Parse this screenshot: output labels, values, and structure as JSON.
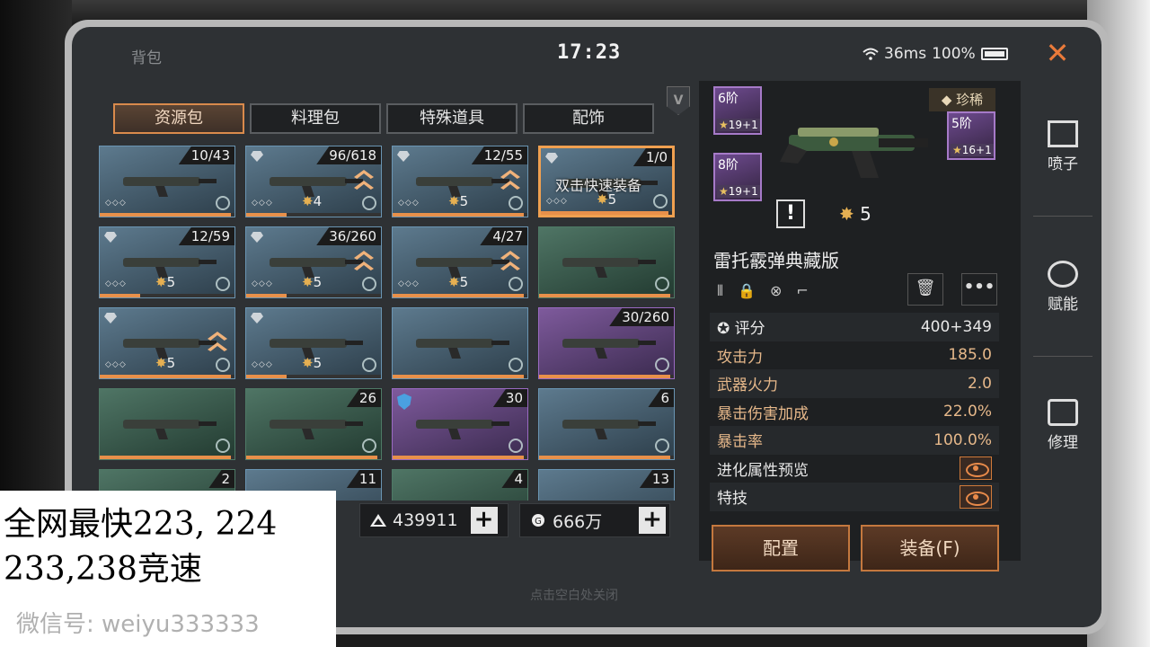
{
  "status": {
    "title": "背包",
    "time": "17:23",
    "ping": "36ms",
    "battery": "100%"
  },
  "vip_badge": "V",
  "tabs": [
    "资源包",
    "料理包",
    "特殊道具",
    "配饰"
  ],
  "grid": [
    {
      "count": "10/43",
      "stars": "",
      "diamond": false,
      "dots": true,
      "upgrade": false,
      "bar": 0.97,
      "rarity": "blue"
    },
    {
      "count": "96/618",
      "stars": "4",
      "diamond": true,
      "dots": true,
      "upgrade": true,
      "bar": 0.3,
      "rarity": "blue"
    },
    {
      "count": "12/55",
      "stars": "5",
      "diamond": true,
      "dots": true,
      "upgrade": true,
      "bar": 0.97,
      "rarity": "blue"
    },
    {
      "count": "1/0",
      "stars": "5",
      "diamond": true,
      "dots": true,
      "upgrade": false,
      "bar": 0.97,
      "rarity": "blue",
      "selected": true,
      "overlay": "双击快速装备"
    },
    {
      "count": "12/59",
      "stars": "5",
      "diamond": true,
      "dots": true,
      "upgrade": false,
      "bar": 0.3,
      "rarity": "blue"
    },
    {
      "count": "36/260",
      "stars": "5",
      "diamond": true,
      "dots": true,
      "upgrade": true,
      "bar": 0.3,
      "rarity": "blue"
    },
    {
      "count": "4/27",
      "stars": "5",
      "diamond": false,
      "dots": true,
      "upgrade": true,
      "bar": 0.97,
      "rarity": "blue"
    },
    {
      "count": "",
      "stars": "",
      "diamond": false,
      "dots": false,
      "upgrade": false,
      "bar": 0.97,
      "rarity": "green"
    },
    {
      "count": "",
      "stars": "5",
      "diamond": true,
      "dots": true,
      "upgrade": true,
      "bar": 0.97,
      "rarity": "blue"
    },
    {
      "count": "",
      "stars": "5",
      "diamond": true,
      "dots": true,
      "upgrade": false,
      "bar": 0.3,
      "rarity": "blue"
    },
    {
      "count": "",
      "stars": "",
      "diamond": false,
      "dots": false,
      "upgrade": false,
      "bar": 0.97,
      "rarity": "blue"
    },
    {
      "count": "30/260",
      "stars": "",
      "diamond": false,
      "dots": false,
      "upgrade": false,
      "bar": 0.97,
      "rarity": "purple"
    },
    {
      "count": "",
      "stars": "",
      "diamond": false,
      "dots": false,
      "upgrade": false,
      "bar": 0.97,
      "rarity": "green"
    },
    {
      "count": "26",
      "stars": "",
      "diamond": false,
      "dots": false,
      "upgrade": false,
      "bar": 0.97,
      "rarity": "green"
    },
    {
      "count": "30",
      "stars": "",
      "diamond": false,
      "dots": false,
      "upgrade": false,
      "bar": 0.97,
      "rarity": "purple",
      "shield": true
    },
    {
      "count": "6",
      "stars": "",
      "diamond": false,
      "dots": false,
      "upgrade": false,
      "bar": 0.97,
      "rarity": "blue"
    },
    {
      "count": "2",
      "stars": "",
      "diamond": false,
      "dots": false,
      "upgrade": false,
      "bar": 0,
      "rarity": "green"
    },
    {
      "count": "11",
      "stars": "",
      "diamond": false,
      "dots": false,
      "upgrade": false,
      "bar": 0,
      "rarity": "blue"
    },
    {
      "count": "4",
      "stars": "",
      "diamond": false,
      "dots": false,
      "upgrade": false,
      "bar": 0,
      "rarity": "green"
    },
    {
      "count": "13",
      "stars": "",
      "diamond": false,
      "dots": false,
      "upgrade": false,
      "bar": 0,
      "rarity": "blue"
    }
  ],
  "resources": {
    "gold": "439911",
    "coins": "666万",
    "plus": "+"
  },
  "hint": "点击空白处关闭",
  "detail": {
    "rarity": "珍稀",
    "tier_6": {
      "label": "6阶",
      "stars": "19+1"
    },
    "tier_8": {
      "label": "8阶",
      "stars": "19+1"
    },
    "tier_5": {
      "label": "5阶",
      "stars": "16+1"
    },
    "excl": "!",
    "star_level": "5",
    "name": "雷托霰弹典藏版",
    "trash": "🗑",
    "more": "•••",
    "stats": [
      {
        "k": "评分",
        "v": "400+349",
        "white": true
      },
      {
        "k": "攻击力",
        "v": "185.0"
      },
      {
        "k": "武器火力",
        "v": "2.0"
      },
      {
        "k": "暴击伤害加成",
        "v": "22.0%"
      },
      {
        "k": "暴击率",
        "v": "100.0%"
      },
      {
        "k": "进化属性预览",
        "eye": true,
        "white": true
      },
      {
        "k": "特技",
        "eye": true,
        "white": true
      }
    ],
    "btn_config": "配置",
    "btn_equip": "装备(F)"
  },
  "side": [
    "喷子",
    "赋能",
    "修理"
  ],
  "promo": {
    "line1": "全网最快223, 224",
    "line2": "233,238竞速",
    "line3": "微信号: weiyu333333"
  },
  "colors": {
    "accent": "#e8904a",
    "selected": "#f0a050",
    "stat_key": "#e6b88a"
  }
}
